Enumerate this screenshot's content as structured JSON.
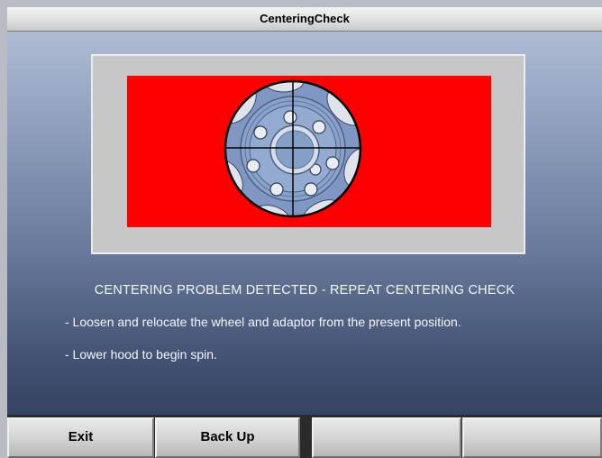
{
  "window": {
    "title": "CenteringCheck"
  },
  "panel": {
    "background_color": "#ff0000",
    "wheel_icon": "wheel-rim-icon"
  },
  "message": {
    "headline": "CENTERING PROBLEM DETECTED - REPEAT CENTERING CHECK",
    "instructions": [
      "- Loosen and relocate the wheel and adaptor from the present position.",
      "- Lower hood to begin spin."
    ]
  },
  "toolbar": {
    "buttons": [
      {
        "label": "Exit"
      },
      {
        "label": "Back Up"
      },
      {
        "label": ""
      },
      {
        "label": ""
      }
    ]
  }
}
